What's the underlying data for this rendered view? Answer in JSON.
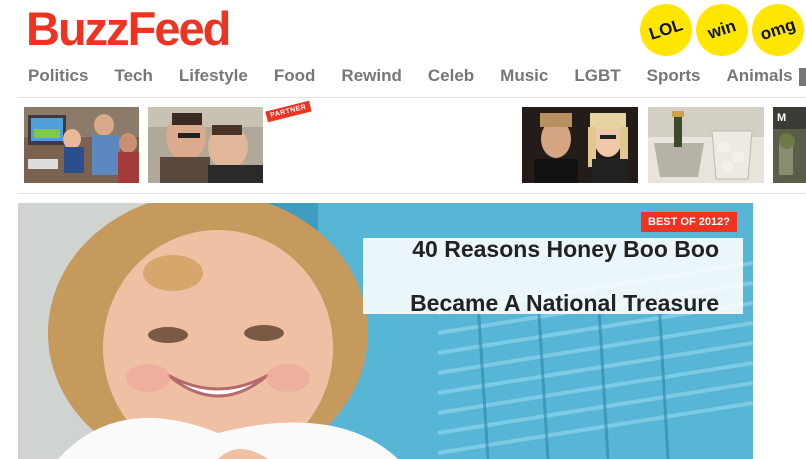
{
  "header": {
    "logo": "BuzzFeed",
    "badges": [
      "LOL",
      "win",
      "omg"
    ],
    "badge_color": "#ffe600",
    "brand_color": "#ee3322"
  },
  "nav": {
    "items": [
      "Politics",
      "Tech",
      "Lifestyle",
      "Food",
      "Rewind",
      "Celeb",
      "Music",
      "LGBT",
      "Sports",
      "Animals"
    ]
  },
  "featured": {
    "partner_label": "PARTNER"
  },
  "hero": {
    "tag": "BEST OF 2012?",
    "title_line1": "40 Reasons Honey Boo Boo",
    "title_line2": "Became A National Treasure"
  },
  "icons": [
    "video-game-kids-thumbnail",
    "kissing-couple-thumbnail",
    "celebrity-couple-thumbnail",
    "champagne-thumbnail",
    "party-thumbnail",
    "smiling-child-hero-image"
  ]
}
